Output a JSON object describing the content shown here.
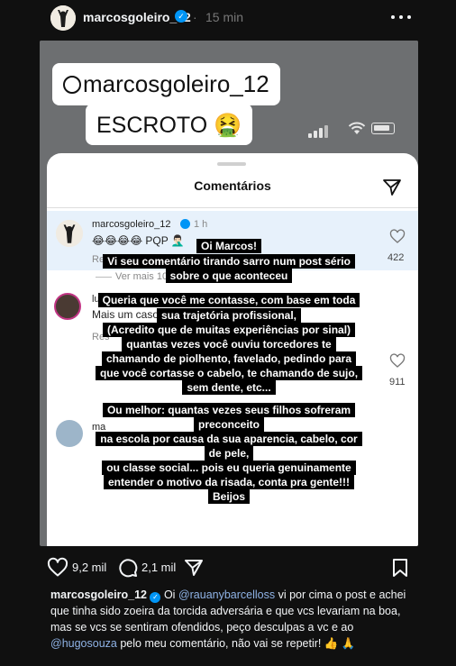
{
  "post": {
    "username": "marcosgoleiro_12",
    "verified_mark": "✓",
    "separator": "·",
    "time": "15 min"
  },
  "media": {
    "sticker_handle": "marcosgoleiro_12",
    "sticker_word": "ESCROTO 🤮",
    "sheet_title": "Comentários",
    "comments": [
      {
        "user": "marcosgoleiro_12",
        "time": "1 h",
        "text": "😂😂😂😂 PQP 🤦🏻‍♂️",
        "reply": "Responder",
        "likes": "422"
      },
      {
        "user": "luiz",
        "text": "Mais um caso i",
        "reply": "Res",
        "likes": "911"
      },
      {
        "user": "ma"
      }
    ],
    "more_replies": "Ver mais 103 respostas",
    "message_lines": [
      "Oi Marcos!",
      "Vi seu comentário tirando sarro num post sério",
      "sobre o que aconteceu",
      "Queria que você me contasse, com base em toda",
      "sua trajetória profissional,",
      "(Acredito que de muitas experiências por sinal)",
      "quantas vezes você ouviu torcedores te",
      "chamando de piolhento, favelado, pedindo para",
      "que você cortasse o cabelo, te chamando de sujo,",
      "sem dente, etc...",
      "Ou melhor: quantas vezes seus filhos sofreram",
      "preconceito",
      "na escola por causa da sua aparencia, cabelo, cor",
      "de pele,",
      "ou classe social... pois eu queria genuinamente",
      "entender o motivo da risada, conta pra gente!!!",
      "Beijos"
    ]
  },
  "actions": {
    "likes": "9,2 mil",
    "comments": "2,1 mil"
  },
  "caption": {
    "user": "marcosgoleiro_12",
    "part1": " Oi ",
    "mention1": "@rauanybarcelloss",
    "part2": " vi por cima o post e achei que tinha sido zoeira da torcida adversária e que vcs levariam na boa, mas se vcs se sentiram ofendidos, peço desculpas a vc e ao ",
    "mention2": "@hugosouza",
    "part3": " pelo meu comentário, não vai se repetir! 👍 🙏"
  },
  "colors": {
    "background": "#101010",
    "verified": "#0095f6",
    "mention": "#8fb3e6"
  }
}
